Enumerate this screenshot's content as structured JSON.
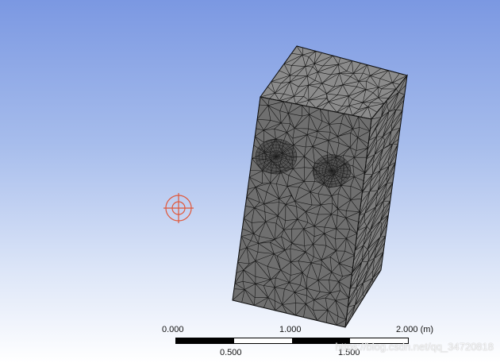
{
  "viewport": {
    "background_top": "#7b98e2",
    "background_bottom": "#ffffff",
    "origin_marker_color": "#e0573a"
  },
  "mesh_object": {
    "name": "meshed-block",
    "face_colors": {
      "top": "#8b8b8b",
      "front": "#6f6f6f",
      "side": "#7d7d7d",
      "edge": "#000000"
    }
  },
  "scale_bar": {
    "top_labels": [
      "0.000",
      "1.000",
      "2.000 (m)"
    ],
    "bottom_labels": [
      "0.500",
      "1.500"
    ],
    "segment_colors": [
      "#000000",
      "#ffffff",
      "#000000",
      "#ffffff"
    ]
  },
  "watermark": "https://blog.csdn.net/qq_34720818"
}
